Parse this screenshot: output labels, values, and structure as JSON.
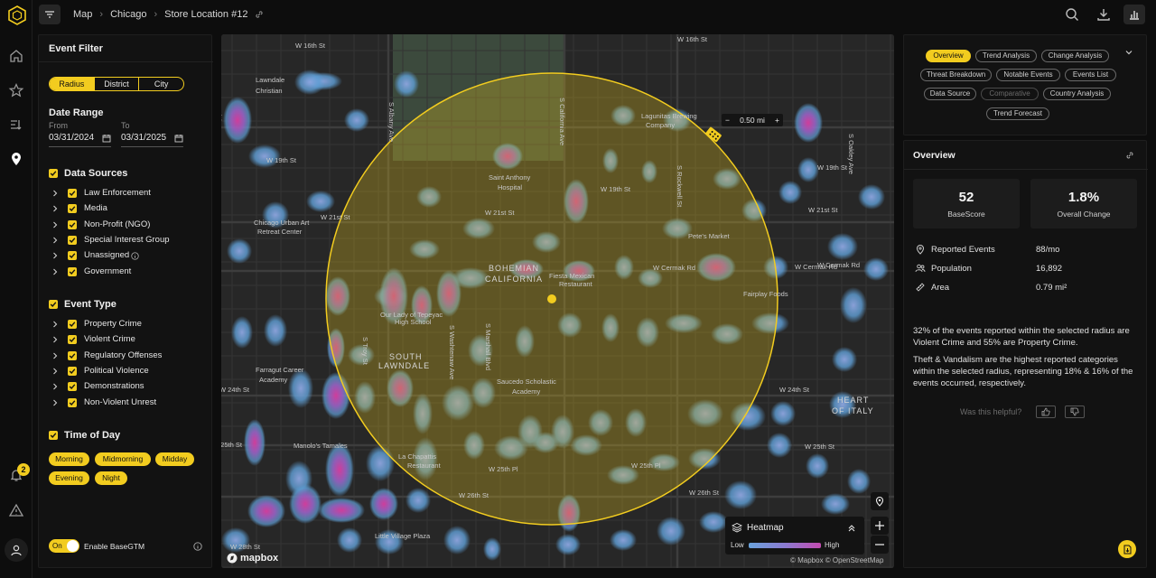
{
  "breadcrumb": [
    "Map",
    "Chicago",
    "Store Location #12"
  ],
  "rail": {
    "notification_count": "2"
  },
  "filter": {
    "title": "Event Filter",
    "segments": [
      "Radius",
      "District",
      "City"
    ],
    "selected_segment": "Radius",
    "date_range": {
      "label": "Date Range",
      "from_label": "From",
      "from": "03/31/2024",
      "to_label": "To",
      "to": "03/31/2025"
    },
    "data_sources": {
      "label": "Data Sources",
      "items": [
        "Law Enforcement",
        "Media",
        "Non-Profit (NGO)",
        "Special Interest Group",
        "Unassigned",
        "Government"
      ]
    },
    "event_type": {
      "label": "Event Type",
      "items": [
        "Property Crime",
        "Violent Crime",
        "Regulatory Offenses",
        "Political Violence",
        "Demonstrations",
        "Non-Violent Unrest"
      ]
    },
    "time_of_day": {
      "label": "Time of Day",
      "chips": [
        "Morning",
        "Midmorning",
        "Midday",
        "Evening",
        "Night"
      ]
    },
    "toggle": {
      "state": "On",
      "label": "Enable BaseGTM"
    }
  },
  "map": {
    "radius_control": {
      "minus": "−",
      "value": "0.50 mi",
      "plus": "+"
    },
    "labels": [
      {
        "t": "W 16th St"
      },
      {
        "t": "W 16th St"
      },
      {
        "t": "Lawndale"
      },
      {
        "t": "Christian"
      },
      {
        "t": "Lagunitas Brewing"
      },
      {
        "t": "Company"
      },
      {
        "t": "W 19th St"
      },
      {
        "t": "W 19th St"
      },
      {
        "t": "W 19th St"
      },
      {
        "t": "Saint Anthony"
      },
      {
        "t": "Hospital"
      },
      {
        "t": "Chicago Urban Art"
      },
      {
        "t": "Retreat Center"
      },
      {
        "t": "W 21st St"
      },
      {
        "t": "W 21st St"
      },
      {
        "t": "W 21st St"
      },
      {
        "t": "Pete's Market"
      },
      {
        "t": "W Cermak Rd"
      },
      {
        "t": "W Cermak Rd"
      },
      {
        "t": "W Cermak Rd"
      },
      {
        "t": "BOHEMIAN"
      },
      {
        "t": "CALIFORNIA"
      },
      {
        "t": "Fiesta Mexican"
      },
      {
        "t": "Restaurant"
      },
      {
        "t": "Fairplay Foods"
      },
      {
        "t": "Our Lady of Tepeyac"
      },
      {
        "t": "High School"
      },
      {
        "t": "SOUTH"
      },
      {
        "t": "LAWNDALE"
      },
      {
        "t": "Saucedo Scholastic"
      },
      {
        "t": "Academy"
      },
      {
        "t": "Farragut Career"
      },
      {
        "t": "Academy"
      },
      {
        "t": "W 24th St"
      },
      {
        "t": "W 24th St"
      },
      {
        "t": "HEART"
      },
      {
        "t": "OF ITALY"
      },
      {
        "t": "W 25th St"
      },
      {
        "t": "W 25th St"
      },
      {
        "t": "Manolo's Tamales"
      },
      {
        "t": "La Chapattis"
      },
      {
        "t": "Restaurant"
      },
      {
        "t": "W 25th Pl"
      },
      {
        "t": "W 25th Pl"
      },
      {
        "t": "W 26th St"
      },
      {
        "t": "W 26th St"
      },
      {
        "t": "Little Village Plaza"
      },
      {
        "t": "W 28th St"
      },
      {
        "t": "S California Ave"
      },
      {
        "t": "S Rockwell St"
      },
      {
        "t": "S Marshall Blvd"
      },
      {
        "t": "S Troy St"
      },
      {
        "t": "S Albany Ave"
      },
      {
        "t": "S Kedzie Ave"
      },
      {
        "t": "S Washtenaw Ave"
      },
      {
        "t": "S Oakley Ave"
      }
    ],
    "legend": {
      "title": "Heatmap",
      "low": "Low",
      "high": "High"
    },
    "brand": "mapbox",
    "attribution": "© Mapbox © OpenStreetMap"
  },
  "tabs": [
    "Overview",
    "Trend Analysis",
    "Change Analysis",
    "Threat Breakdown",
    "Notable Events",
    "Events List",
    "Data Source",
    "Comparative",
    "Country Analysis",
    "Trend Forecast"
  ],
  "selected_tab": "Overview",
  "overview": {
    "title": "Overview",
    "kpis": [
      {
        "value": "52",
        "caption": "BaseScore"
      },
      {
        "value": "1.8%",
        "caption": "Overall Change"
      }
    ],
    "stats": [
      {
        "key": "Reported Events",
        "value": "88/mo"
      },
      {
        "key": "Population",
        "value": "16,892"
      },
      {
        "key": "Area",
        "value": "0.79 mi²"
      }
    ],
    "summary_1": "32% of the events reported within the selected radius are Violent Crime and 55% are Property Crime.",
    "summary_2": "Theft & Vandalism are the highest reported categories within the selected radius, representing 18% & 16% of the events occurred, respectively.",
    "helpful_prompt": "Was this helpful?"
  },
  "colors": {
    "accent": "#f2cc1f",
    "heat_low": "#6aa2db",
    "heat_high": "#c34bb0"
  }
}
